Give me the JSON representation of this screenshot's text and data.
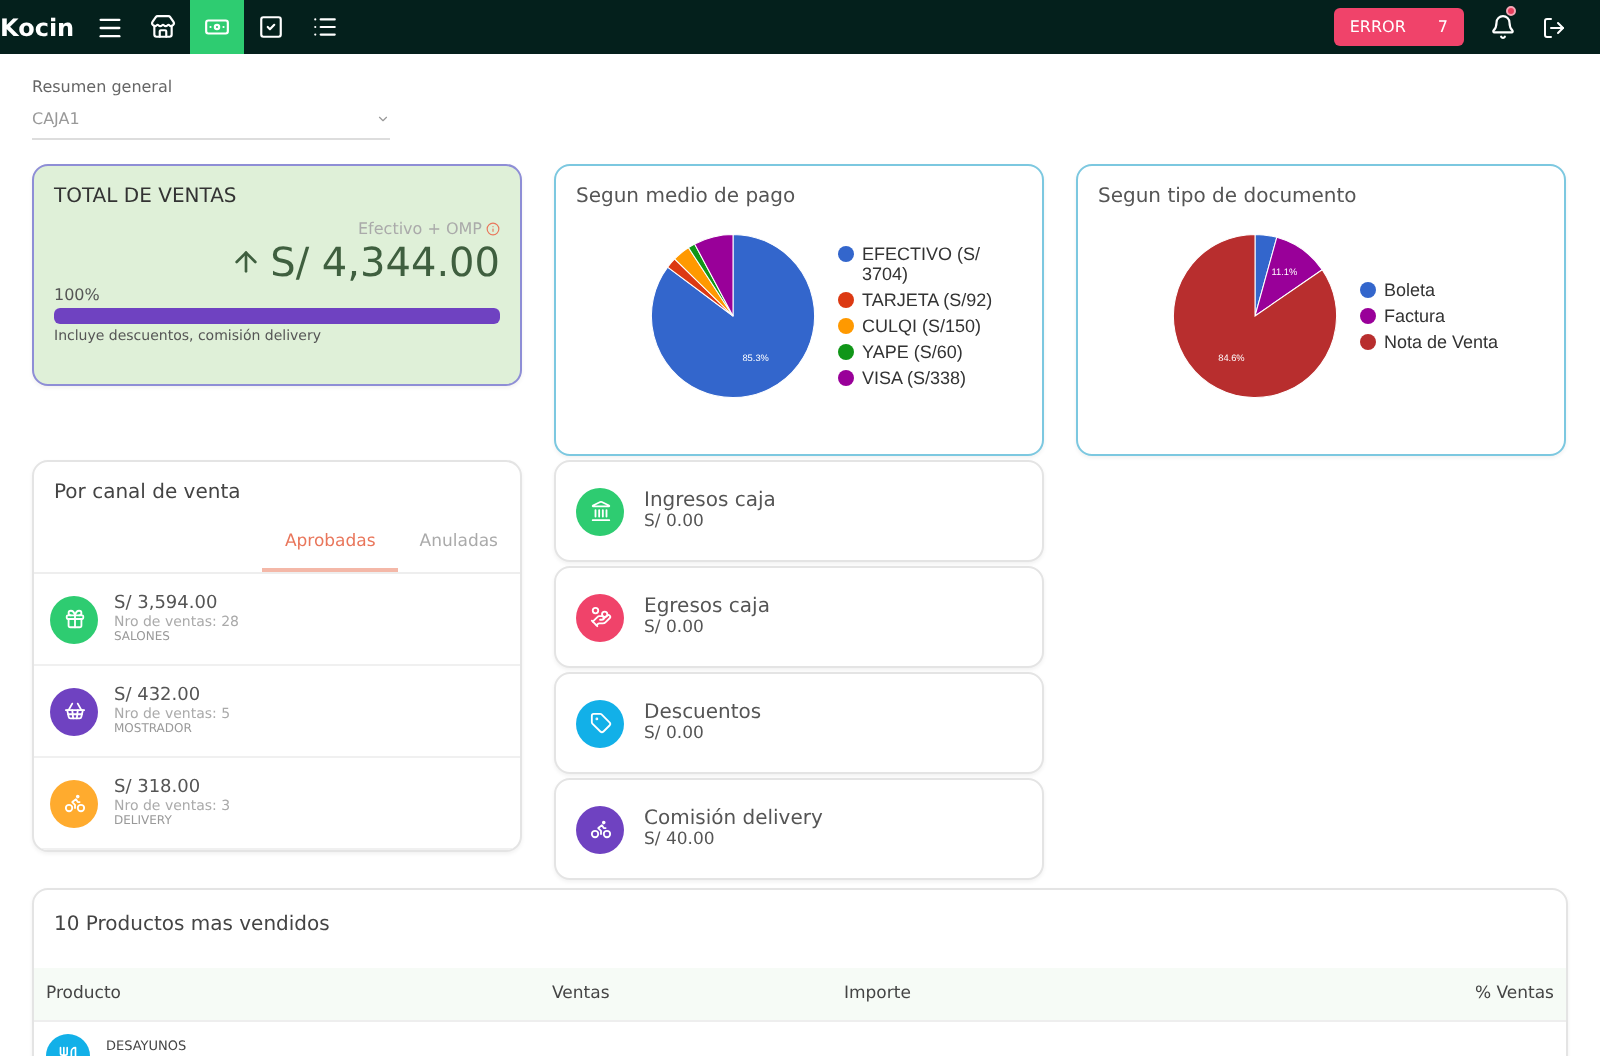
{
  "topbar": {
    "logo": "Kocin",
    "nav": [
      {
        "selected": false
      },
      {
        "selected": true
      },
      {
        "selected": false
      },
      {
        "selected": false
      }
    ],
    "error": {
      "label": "ERROR",
      "count": "7"
    },
    "bell_dot": true
  },
  "filter": {
    "label": "Resumen general",
    "value": "CAJA1"
  },
  "total": {
    "title": "TOTAL DE VENTAS",
    "subtitle": "Efectivo + OMP",
    "amount": "S/ 4,344.00",
    "percent": "100%",
    "level": 1,
    "note": "Incluye descuentos, comisión delivery"
  },
  "payment": {
    "title": "Segun medio de pago",
    "chart_data": {
      "type": "pie",
      "categories": [
        "EFECTIVO (S/ 3704)",
        "TARJETA (S/92)",
        "CULQI (S/150)",
        "YAPE (S/60)",
        "VISA (S/338)"
      ],
      "values": [
        85.3,
        2.1,
        3.5,
        1.4,
        7.8
      ],
      "colors": [
        "#3366cc",
        "#dc3912",
        "#ff9900",
        "#109618",
        "#990099"
      ],
      "value_labels": [
        "85.3%",
        null,
        null,
        null,
        null
      ]
    }
  },
  "document": {
    "title": "Segun tipo de documento",
    "chart_data": {
      "type": "pie",
      "categories": [
        "Boleta",
        "Factura",
        "Nota de Venta"
      ],
      "values": [
        4.3,
        11.1,
        84.6
      ],
      "colors": [
        "#3366cc",
        "#990099",
        "#b82e2e"
      ],
      "value_labels": [
        null,
        "11.1%",
        "84.6%"
      ]
    }
  },
  "channels": {
    "title": "Por canal de venta",
    "tabs": [
      {
        "label": "Aprobadas",
        "selected": true
      },
      {
        "label": "Anuladas",
        "selected": false
      }
    ],
    "items": [
      {
        "amount": "S/ 3,594.00",
        "count": "Nro de ventas: 28",
        "name": "SALONES",
        "color": "#2ecc71"
      },
      {
        "amount": "S/ 432.00",
        "count": "Nro de ventas: 5",
        "name": "MOSTRADOR",
        "color": "#6f42c1"
      },
      {
        "amount": "S/ 318.00",
        "count": "Nro de ventas: 3",
        "name": "DELIVERY",
        "color": "#ffab2e"
      }
    ]
  },
  "stats": [
    {
      "label": "Ingresos caja",
      "amount": "S/ 0.00",
      "color": "#2ecc71"
    },
    {
      "label": "Egresos caja",
      "amount": "S/ 0.00",
      "color": "#f0436a"
    },
    {
      "label": "Descuentos",
      "amount": "S/ 0.00",
      "color": "#12b0e8"
    },
    {
      "label": "Comisión delivery",
      "amount": "S/ 40.00",
      "color": "#6f42c1"
    }
  ],
  "products": {
    "title": "10 Productos mas vendidos",
    "columns": [
      "Producto",
      "Ventas",
      "Importe",
      "% Ventas"
    ],
    "rows": [
      {
        "name": "DESAYUNOS"
      }
    ]
  }
}
